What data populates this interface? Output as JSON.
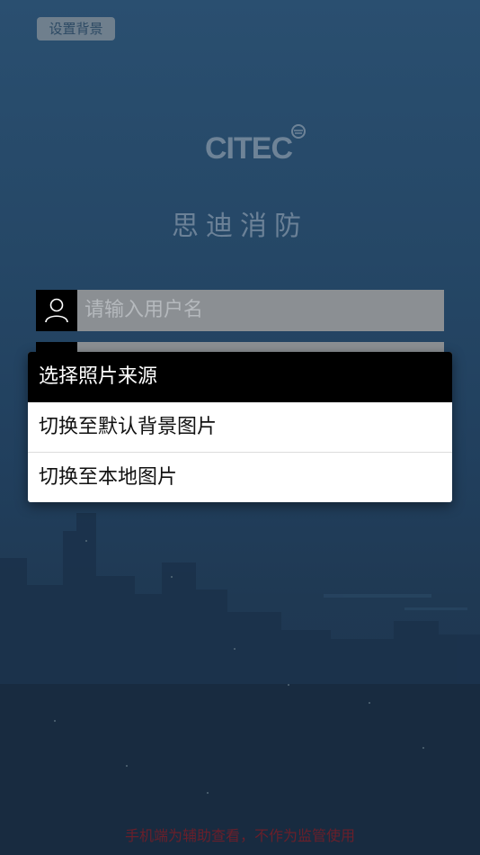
{
  "header": {
    "set_background_label": "设置背景"
  },
  "brand": {
    "logo_text": "CITEC",
    "app_name": "思迪消防"
  },
  "login": {
    "username_placeholder": "请输入用户名"
  },
  "dialog": {
    "title": "选择照片来源",
    "options": [
      {
        "label": "切换至默认背景图片"
      },
      {
        "label": "切换至本地图片"
      }
    ]
  },
  "footer": {
    "note": "手机端为辅助查看，不作为监管使用"
  },
  "colors": {
    "background": "#213f5d",
    "dialog_title_bg": "#000000",
    "input_bg": "#8b8f93",
    "footer_text": "#6a1f2a"
  },
  "icons": {
    "username": "user-icon"
  }
}
